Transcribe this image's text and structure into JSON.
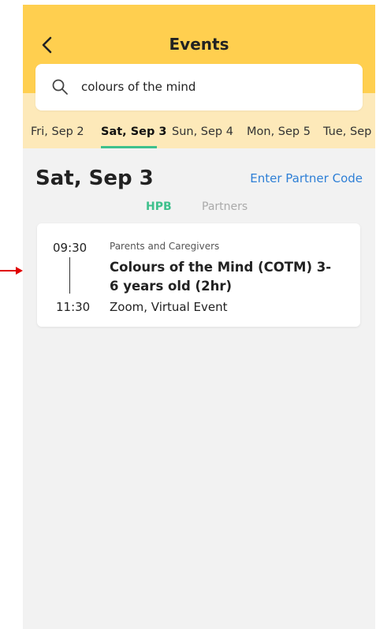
{
  "header": {
    "title": "Events",
    "back_icon": "chevron-left-icon"
  },
  "search": {
    "value": "colours of the mind",
    "icon": "search-icon"
  },
  "date_tabs": [
    {
      "label": "Fri, Sep 2",
      "active": false
    },
    {
      "label": "Sat, Sep 3",
      "active": true
    },
    {
      "label": "Sun, Sep 4",
      "active": false
    },
    {
      "label": "Mon, Sep 5",
      "active": false
    },
    {
      "label": "Tue, Sep",
      "active": false
    }
  ],
  "day": {
    "heading": "Sat, Sep 3",
    "partner_code_label": "Enter Partner Code"
  },
  "segments": {
    "hpb": "HPB",
    "partners": "Partners",
    "active": "HPB"
  },
  "events": [
    {
      "start": "09:30",
      "end": "11:30",
      "category": "Parents and Caregivers",
      "title": "Colours of the Mind (COTM) 3-6 years old (2hr)",
      "location": "Zoom, Virtual Event"
    }
  ],
  "colors": {
    "header_bg": "#ffcf4f",
    "tab_strip_bg": "#fde9b9",
    "accent_green": "#3ec08c",
    "link_blue": "#2e7fd6",
    "page_bg": "#f2f2f2",
    "annotation_arrow": "#e00000"
  }
}
